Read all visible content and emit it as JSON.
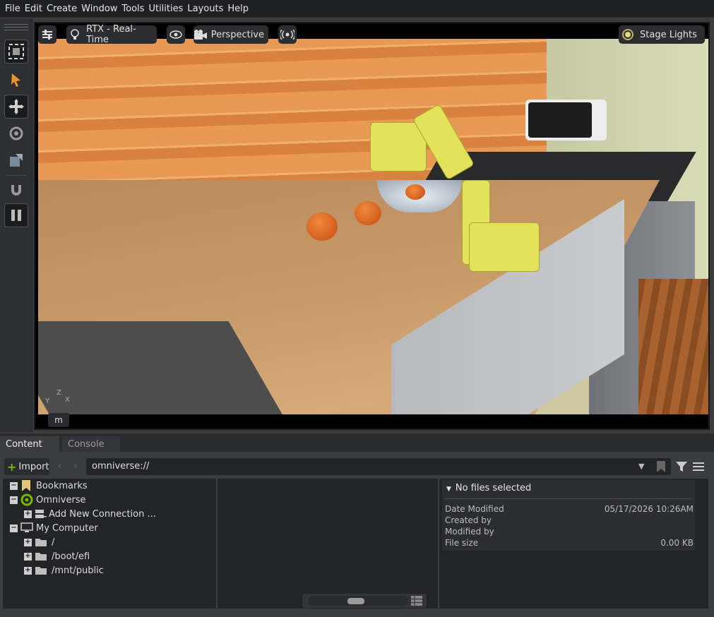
{
  "menu": [
    "File",
    "Edit",
    "Create",
    "Window",
    "Tools",
    "Utilities",
    "Layouts",
    "Help"
  ],
  "viewport": {
    "renderer_label": "RTX - Real-Time",
    "camera_label": "Perspective",
    "lights_label": "Stage Lights",
    "m_button": "m",
    "axis_z": "Z",
    "axis_y": "Y",
    "axis_x": "X"
  },
  "tabs": {
    "content": "Content",
    "console": "Console"
  },
  "toolbar": {
    "import_label": "Import",
    "path": "omniverse://"
  },
  "tree": {
    "bookmarks": "Bookmarks",
    "omniverse": "Omniverse",
    "add_connection": "Add New Connection ...",
    "my_computer": "My Computer",
    "root": "/",
    "boot_efi": "/boot/efi",
    "mnt_public": "/mnt/public"
  },
  "info": {
    "header": "No files selected",
    "date_modified_label": "Date Modified",
    "date_modified_value": "05/17/2026 10:26AM",
    "created_by_label": "Created by",
    "modified_by_label": "Modified by",
    "file_size_label": "File size",
    "file_size_value": "0.00 KB"
  },
  "colors": {
    "accent_orange": "#e8922e",
    "accent_green": "#76b900"
  }
}
